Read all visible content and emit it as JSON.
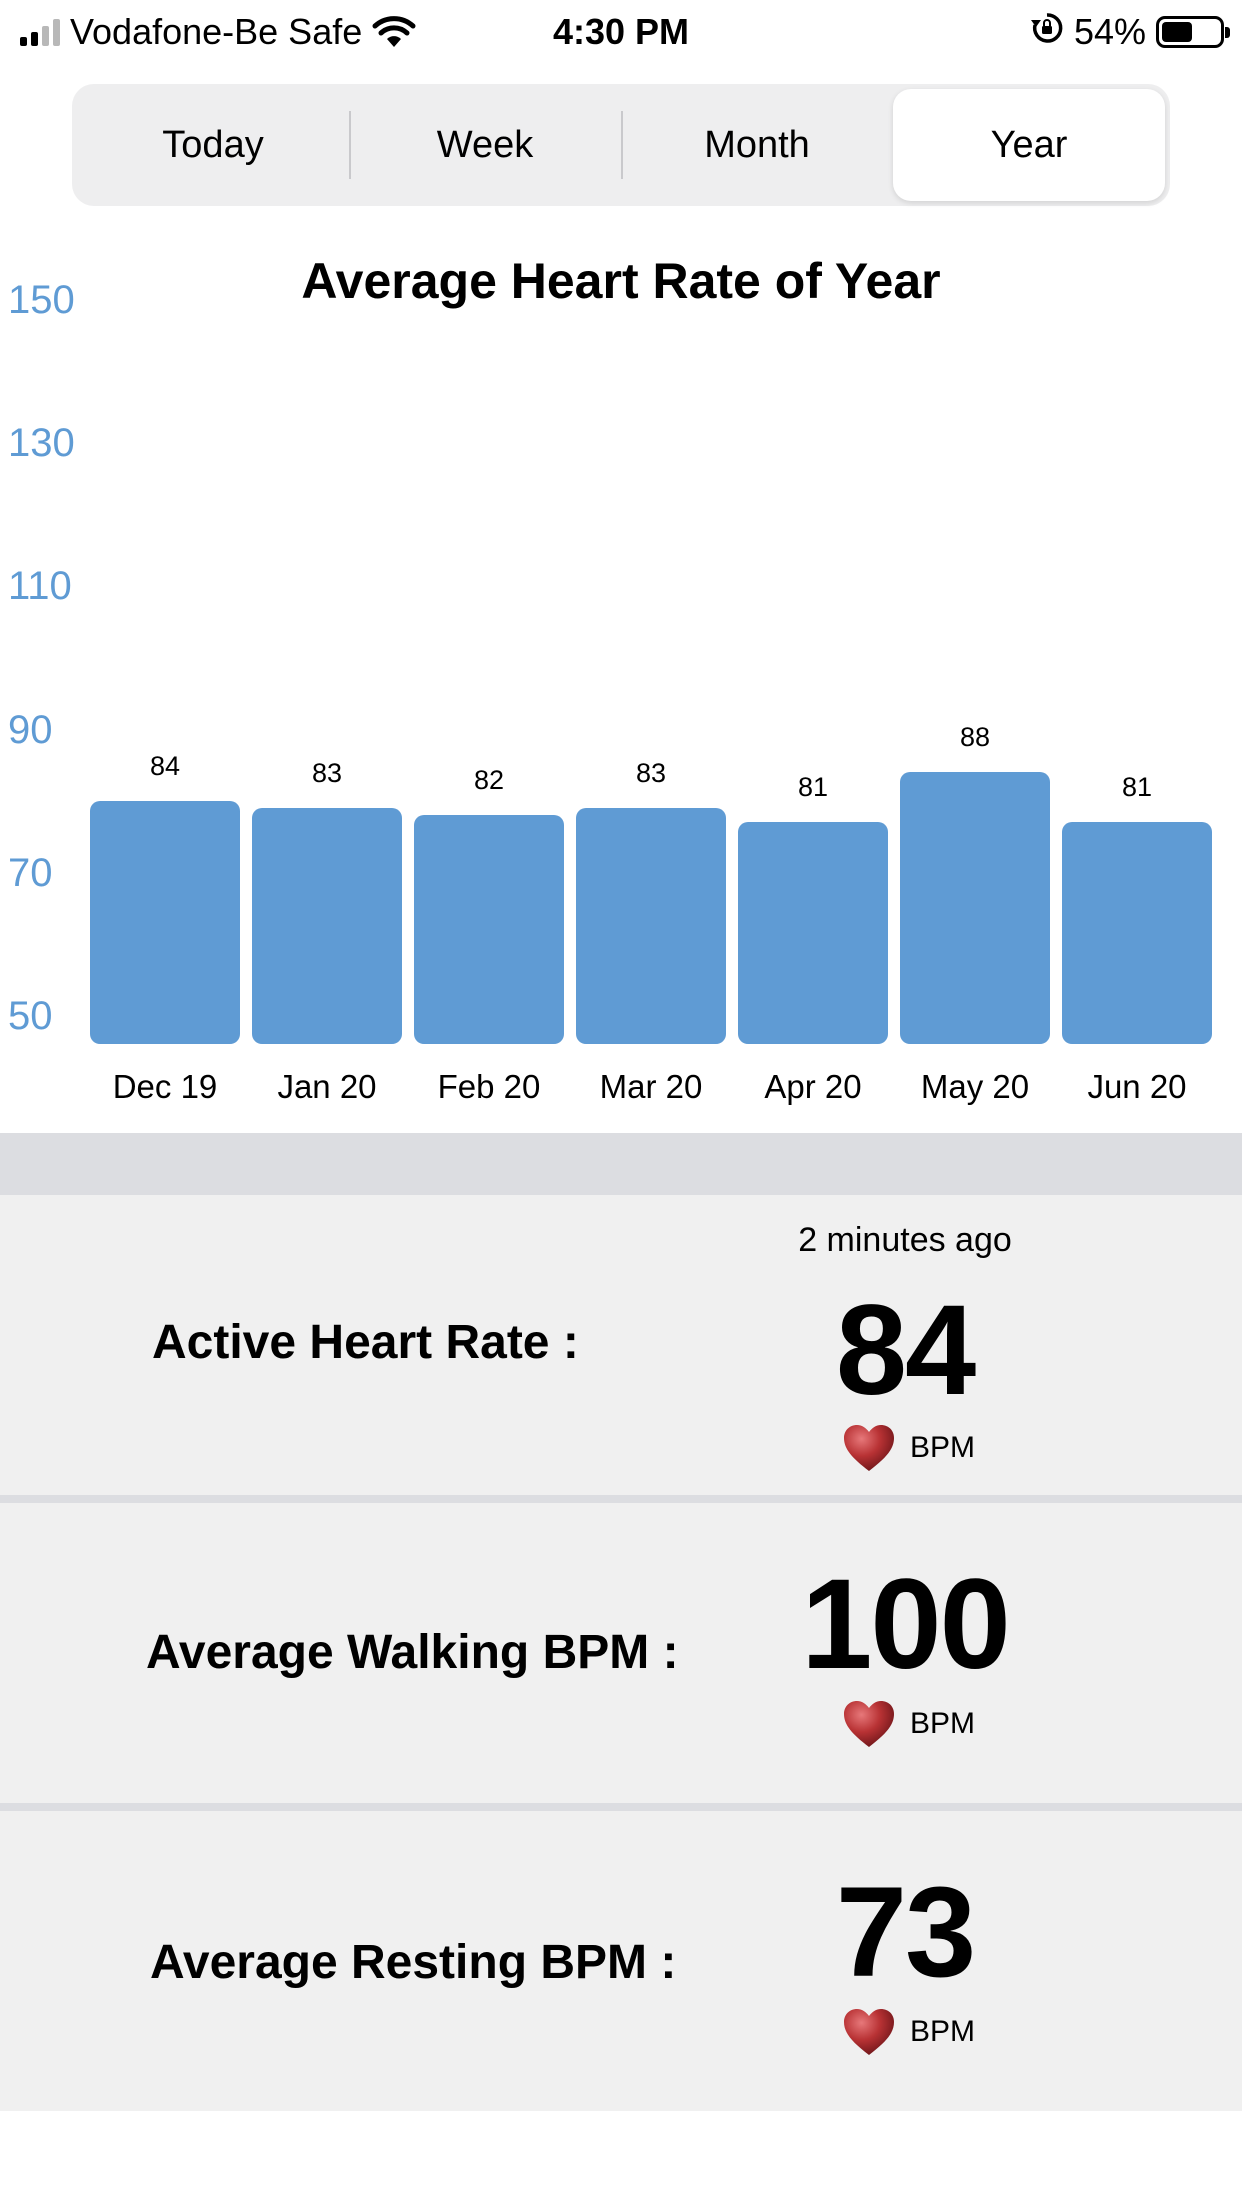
{
  "status_bar": {
    "carrier": "Vodafone-Be Safe",
    "time": "4:30 PM",
    "battery": "54%"
  },
  "segments": [
    {
      "label": "Today",
      "active": false
    },
    {
      "label": "Week",
      "active": false
    },
    {
      "label": "Month",
      "active": false
    },
    {
      "label": "Year",
      "active": true
    }
  ],
  "chart_data": {
    "type": "bar",
    "title": "Average Heart Rate of Year",
    "categories": [
      "Dec 19",
      "Jan 20",
      "Feb 20",
      "Mar 20",
      "Apr 20",
      "May 20",
      "Jun 20"
    ],
    "values": [
      84,
      83,
      82,
      83,
      81,
      88,
      81
    ],
    "ylim": [
      50,
      150
    ],
    "yticks": [
      "150",
      "130",
      "110",
      "90",
      "70",
      "50"
    ],
    "bar_color": "#5f9bd4",
    "grid": false
  },
  "stats": {
    "active": {
      "label": "Active Heart Rate :",
      "time": "2 minutes ago",
      "value": "84",
      "unit": "BPM"
    },
    "walking": {
      "label": "Average Walking BPM :",
      "value": "100",
      "unit": "BPM"
    },
    "resting": {
      "label": "Average Resting BPM :",
      "value": "73",
      "unit": "BPM"
    }
  },
  "icons": {
    "heart": "heart-icon",
    "wifi": "wifi-icon",
    "rotation_lock": "rotation-lock-icon"
  }
}
